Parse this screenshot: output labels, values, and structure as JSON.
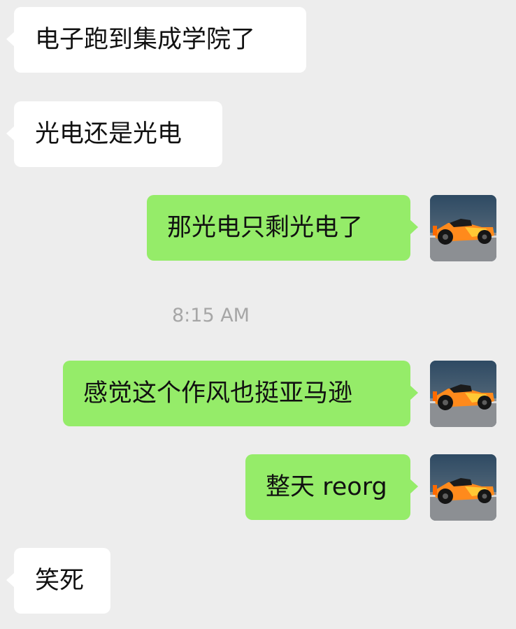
{
  "chat": {
    "messages": [
      {
        "direction": "in",
        "text": "电子跑到集成学院了"
      },
      {
        "direction": "in",
        "text": "光电还是光电"
      },
      {
        "direction": "out",
        "text": "那光电只剩光电了"
      },
      {
        "direction": "out",
        "text": "感觉这个作风也挺亚马逊"
      },
      {
        "direction": "out",
        "text": "整天 reorg"
      },
      {
        "direction": "in",
        "text": "笑死"
      }
    ],
    "timestamp": "8:15 AM"
  },
  "colors": {
    "background": "#ededed",
    "incoming_bubble": "#ffffff",
    "outgoing_bubble": "#95ec69",
    "timestamp_text": "#a6a6a6"
  },
  "icons": {
    "avatar": "race-car-avatar-icon"
  }
}
